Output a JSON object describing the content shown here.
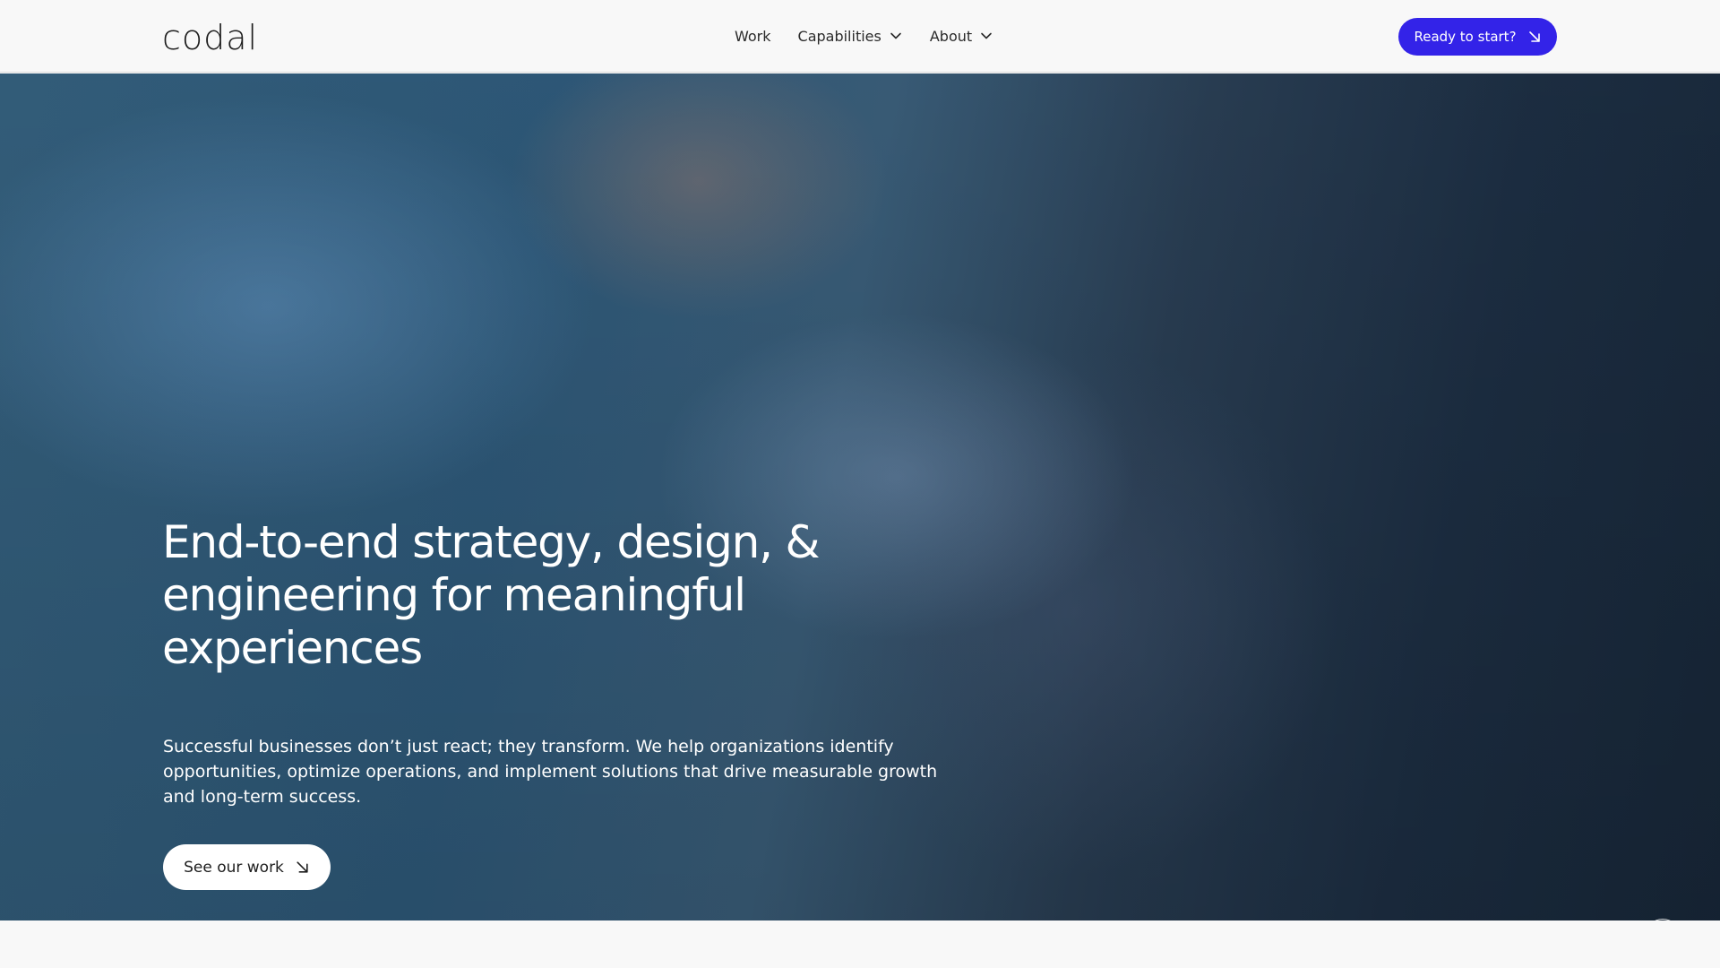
{
  "header": {
    "logo": "codal",
    "nav": [
      {
        "label": "Work",
        "has_dropdown": false
      },
      {
        "label": "Capabilities",
        "has_dropdown": true
      },
      {
        "label": "About",
        "has_dropdown": true
      }
    ],
    "cta_label": "Ready to start?",
    "cta_icon": "arrow-down-right-icon"
  },
  "hero": {
    "title": "End-to-end strategy, design, & engineering for meaningful experiences",
    "description": "Successful businesses don’t just react; they transform. We help organizations identify opportunities, optimize operations, and implement solutions that drive measurable growth and long-term success.",
    "button_label": "See our work",
    "button_icon": "arrow-down-right-icon",
    "video_control_icon": "pause-icon"
  },
  "colors": {
    "accent": "#3323e8",
    "page_bg": "#f8f8f8",
    "hero_text": "#ffffff"
  }
}
